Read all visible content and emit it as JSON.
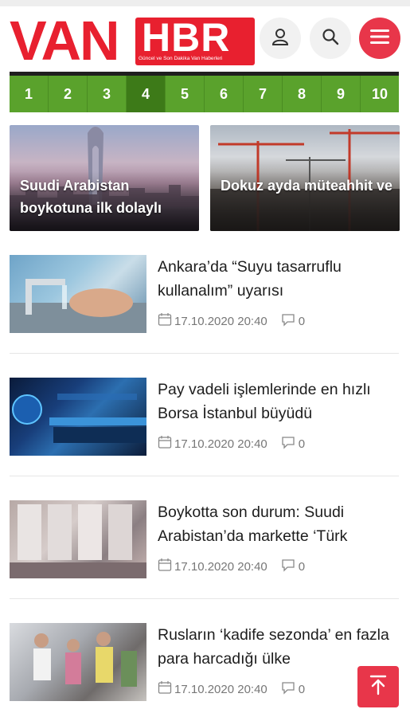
{
  "header": {
    "logo_van": "VAN",
    "logo_hbr": "HBR",
    "logo_tagline": "Güncel ve Son Dakika Van Haberleri"
  },
  "pager": {
    "pages": [
      "1",
      "2",
      "3",
      "4",
      "5",
      "6",
      "7",
      "8",
      "9",
      "10"
    ],
    "active": "4"
  },
  "featured": [
    {
      "title": "Suudi Arabistan boykotuna ilk dolaylı"
    },
    {
      "title": "Dokuz ayda müteahhit ve"
    }
  ],
  "news": [
    {
      "headline": "Ankara’da “Suyu tasarruflu kullanalım” uyarısı",
      "date": "17.10.2020 20:40",
      "comments": "0"
    },
    {
      "headline": "Pay vadeli işlemlerinde en hızlı Borsa İstanbul büyüdü",
      "date": "17.10.2020 20:40",
      "comments": "0"
    },
    {
      "headline": "Boykotta son durum: Suudi Arabistan’da markette ‘Türk",
      "date": "17.10.2020 20:40",
      "comments": "0"
    },
    {
      "headline": "Rusların ‘kadife sezonda’ en fazla para harcadığı ülke",
      "date": "17.10.2020 20:40",
      "comments": "0"
    }
  ],
  "icons": {
    "user": "user-icon",
    "search": "search-icon",
    "menu": "hamburger-menu-icon",
    "calendar": "calendar-icon",
    "comment": "comment-icon",
    "scroll_top": "arrow-up-to-top-icon"
  },
  "colors": {
    "brand_red": "#e8202f",
    "pager_green": "#5aa22c",
    "pager_active": "#3d7a18"
  }
}
